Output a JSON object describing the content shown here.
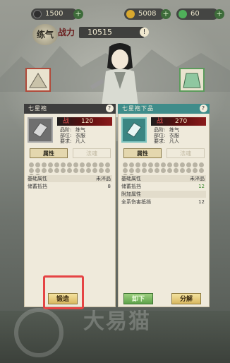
{
  "resources": {
    "energy": "1500",
    "gold": "5008",
    "jade": "60"
  },
  "header": {
    "seal": "练气",
    "power_label": "战力",
    "power_value": "10515"
  },
  "left_panel": {
    "title": "七星袍",
    "stat_key": "战",
    "stat_value": "120",
    "attrs": [
      {
        "k": "品阶:",
        "v": "练气"
      },
      {
        "k": "部位:",
        "v": "衣服"
      },
      {
        "k": "要求:",
        "v": "凡人"
      }
    ],
    "tab_active": "属性",
    "tab_inactive": "法魂",
    "rows": [
      {
        "k": "基础属性",
        "v": "未淬品"
      },
      {
        "k": "储蓄抵挡",
        "v": "8"
      }
    ],
    "button": "锻造"
  },
  "right_panel": {
    "title": "七星袍下品",
    "stat_key": "战",
    "stat_value": "270",
    "attrs": [
      {
        "k": "品阶:",
        "v": "练气"
      },
      {
        "k": "部位:",
        "v": "衣服"
      },
      {
        "k": "要求:",
        "v": "凡人"
      }
    ],
    "tab_active": "属性",
    "tab_inactive": "法魂",
    "rows": [
      {
        "k": "基础属性",
        "v": "未淬品"
      },
      {
        "k": "储蓄抵挡",
        "v": "12"
      },
      {
        "k": "附加属性",
        "v": ""
      },
      {
        "k": "全系伤害抵挡",
        "v": "12"
      }
    ],
    "button_left": "卸下",
    "button_right": "分解"
  },
  "watermark": "大易猫"
}
